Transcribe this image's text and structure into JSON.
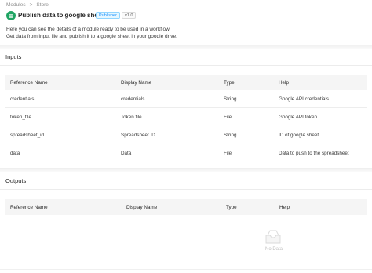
{
  "breadcrumb": {
    "items": [
      "Modules",
      "Store"
    ],
    "separator": ">"
  },
  "header": {
    "title": "Publish data to google sheet.",
    "tag_publisher": "Publisher",
    "tag_version": "v1.0",
    "logo_icon": "google-sheets-icon",
    "description_line1": "Here you can see the details of a module ready to be used in a workflow.",
    "description_line2": "Get data from input file and publish it to a google sheet in your goodle drive."
  },
  "inputs": {
    "title": "Inputs",
    "columns": [
      "Reference Name",
      "Display Name",
      "Type",
      "Help"
    ],
    "rows": [
      [
        "credentials",
        "credentials",
        "String",
        "Google API credentials"
      ],
      [
        "token_file",
        "Token file",
        "File",
        "Google API token"
      ],
      [
        "spreadsheet_id",
        "Spreadsheet ID",
        "String",
        "ID of google sheet"
      ],
      [
        "data",
        "Data",
        "File",
        "Data to push to the spreadsheet"
      ]
    ]
  },
  "outputs": {
    "title": "Outputs",
    "columns": [
      "Reference Name",
      "Display Name",
      "Type",
      "Help"
    ],
    "empty_text": "No Data",
    "empty_icon": "empty-inbox-icon"
  },
  "colors": {
    "brand_green": "#1fa463",
    "tag_blue": "#1890ff",
    "header_bg": "#f5f5f5"
  }
}
